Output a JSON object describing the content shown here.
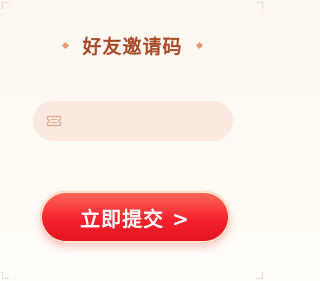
{
  "title": "好友邀请码",
  "input": {
    "value": "",
    "placeholder": ""
  },
  "submit_label": "立即提交 >",
  "icons": {
    "title_decoration": "diamond-icon",
    "input_prefix": "ticket-icon"
  },
  "colors": {
    "title": "#a84a27",
    "button": "#f5222d",
    "input_bg": "#fbe9e1",
    "accent": "#e79a72"
  }
}
